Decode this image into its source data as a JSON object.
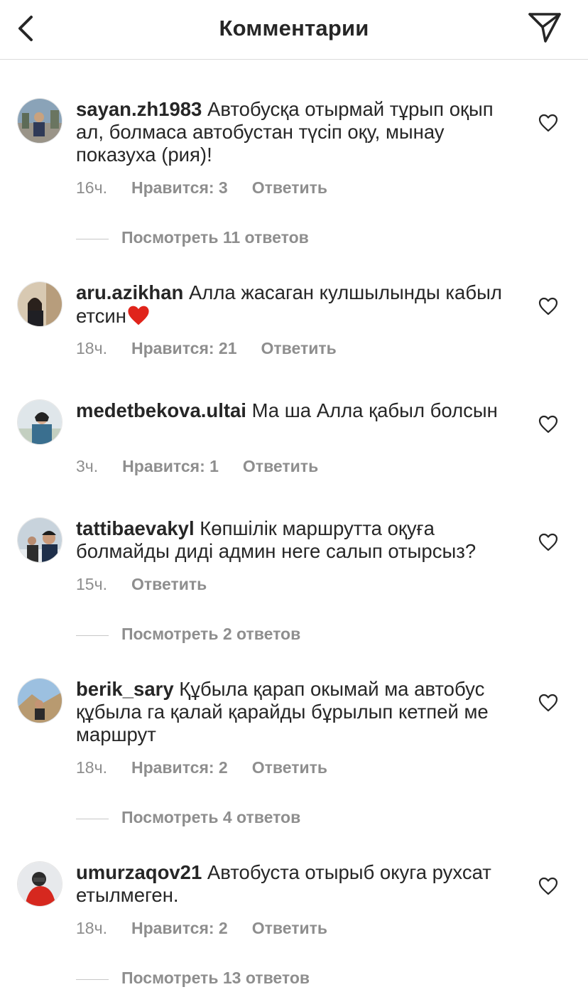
{
  "header": {
    "title": "Комментарии",
    "back_icon": "chevron-left-icon",
    "share_icon": "paper-plane-icon"
  },
  "comments": [
    {
      "username": "sayan.zh1983",
      "text": "Автобусқа отырмай тұрып оқып ал, болмаса автобустан түсіп оқу, мынау  показуха (рия)!",
      "time": "16ч.",
      "likes": "Нравится: 3",
      "reply": "Ответить",
      "view_replies": "Посмотреть 11 ответов"
    },
    {
      "username": "aru.azikhan",
      "text": "Алла жасаган кулшылынды кабыл етсин",
      "emoji": "❤️",
      "time": "18ч.",
      "likes": "Нравится: 21",
      "reply": "Ответить"
    },
    {
      "username": "medetbekova.ultai",
      "text": "Ма ша Алла қабыл болсын",
      "time": "3ч.",
      "likes": "Нравится: 1",
      "reply": "Ответить"
    },
    {
      "username": "tattibaevakyl",
      "text": "Көпшілік маршрутта оқуға болмайды диді админ неге салып отырсыз?",
      "time": "15ч.",
      "reply": "Ответить",
      "view_replies": "Посмотреть 2 ответов"
    },
    {
      "username": "berik_sary",
      "text": "Құбыла қарап окымай ма автобус құбыла га қалай қарайды бұрылып кетпей ме маршрут",
      "time": "18ч.",
      "likes": "Нравится: 2",
      "reply": "Ответить",
      "view_replies": "Посмотреть 4 ответов"
    },
    {
      "username": "umurzaqov21",
      "text": "Автобуста отырыб окуга рухсат етылмеген.",
      "time": "18ч.",
      "likes": "Нравится: 2",
      "reply": "Ответить",
      "view_replies": "Посмотреть 13 ответов"
    }
  ],
  "colors": {
    "text": "#262626",
    "secondary": "#8e8e8e",
    "divider": "#dbdbdb",
    "heart_emoji": "#e0241b"
  },
  "icons": {
    "like": "heart-outline-icon"
  }
}
